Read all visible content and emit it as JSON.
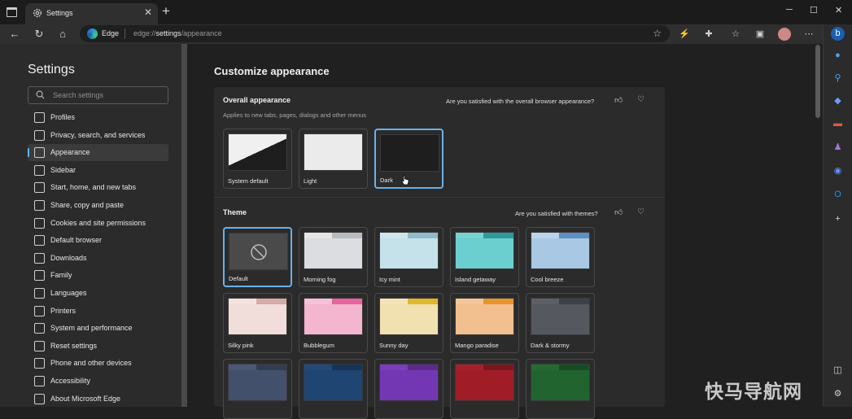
{
  "window": {
    "tab_title": "Settings",
    "tab_close": "✕",
    "new_tab": "+",
    "minimize": "─",
    "maximize": "☐",
    "close": "✕"
  },
  "toolbar": {
    "back": "←",
    "refresh": "↻",
    "home": "⌂",
    "edge_label": "Edge",
    "url_prefix": "edge://",
    "url_bold": "settings",
    "url_suffix": "/appearance",
    "more": "⋯"
  },
  "sidebar": {
    "title": "Settings",
    "search_placeholder": "Search settings",
    "items": [
      {
        "label": "Profiles",
        "icon": "profile-icon"
      },
      {
        "label": "Privacy, search, and services",
        "icon": "lock-icon"
      },
      {
        "label": "Appearance",
        "icon": "palette-icon",
        "active": true
      },
      {
        "label": "Sidebar",
        "icon": "sidebar-icon"
      },
      {
        "label": "Start, home, and new tabs",
        "icon": "home-icon"
      },
      {
        "label": "Share, copy and paste",
        "icon": "share-icon"
      },
      {
        "label": "Cookies and site permissions",
        "icon": "cookie-icon"
      },
      {
        "label": "Default browser",
        "icon": "browser-icon"
      },
      {
        "label": "Downloads",
        "icon": "download-icon"
      },
      {
        "label": "Family",
        "icon": "family-icon"
      },
      {
        "label": "Languages",
        "icon": "language-icon"
      },
      {
        "label": "Printers",
        "icon": "printer-icon"
      },
      {
        "label": "System and performance",
        "icon": "system-icon"
      },
      {
        "label": "Reset settings",
        "icon": "reset-icon"
      },
      {
        "label": "Phone and other devices",
        "icon": "phone-icon"
      },
      {
        "label": "Accessibility",
        "icon": "accessibility-icon"
      },
      {
        "label": "About Microsoft Edge",
        "icon": "edge-icon"
      }
    ]
  },
  "main": {
    "title": "Customize appearance",
    "overall": {
      "title": "Overall appearance",
      "subtitle": "Applies to new tabs, pages, dialogs and other menus",
      "feedback": "Are you satisfied with the overall browser appearance?",
      "options": [
        {
          "label": "System default",
          "selected": false
        },
        {
          "label": "Light",
          "selected": false
        },
        {
          "label": "Dark",
          "selected": true
        }
      ]
    },
    "theme": {
      "title": "Theme",
      "feedback": "Are you satisfied with themes?",
      "tiles": [
        {
          "label": "Default",
          "selected": true,
          "tab": "#444444",
          "back": "#4a4a4a",
          "front": "#4a4a4a"
        },
        {
          "label": "Morning fog",
          "selected": false,
          "tab": "#e6e6e6",
          "back": "#b8bcc0",
          "front": "#dcdde0"
        },
        {
          "label": "Icy mint",
          "selected": false,
          "tab": "#cfe6ee",
          "back": "#8fbccb",
          "front": "#c5e2ea"
        },
        {
          "label": "Island getaway",
          "selected": false,
          "tab": "#78d3d3",
          "back": "#2e9a9c",
          "front": "#6ccfcf"
        },
        {
          "label": "Cool breeze",
          "selected": false,
          "tab": "#b9d4ec",
          "back": "#5d8fc1",
          "front": "#a9c8e4"
        },
        {
          "label": "Silky pink",
          "selected": false,
          "tab": "#f5e2df",
          "back": "#d6aaa6",
          "front": "#f1ddd9"
        },
        {
          "label": "Bubblegum",
          "selected": false,
          "tab": "#f8c1d8",
          "back": "#e7649f",
          "front": "#f4b5cf"
        },
        {
          "label": "Sunny day",
          "selected": false,
          "tab": "#f3e3b7",
          "back": "#e0b82a",
          "front": "#f1e0b0"
        },
        {
          "label": "Mango paradise",
          "selected": false,
          "tab": "#f5c69a",
          "back": "#e8932c",
          "front": "#f2bf8f"
        },
        {
          "label": "Dark & stormy",
          "selected": false,
          "tab": "#5c5f66",
          "back": "#3d4046",
          "front": "#55585e"
        },
        {
          "label": "",
          "selected": false,
          "tab": "#4a5876",
          "back": "#333d52",
          "front": "#43506c"
        },
        {
          "label": "",
          "selected": false,
          "tab": "#22497a",
          "back": "#163457",
          "front": "#1f4572"
        },
        {
          "label": "",
          "selected": false,
          "tab": "#7a3dbb",
          "back": "#5a2b8c",
          "front": "#7437b4"
        },
        {
          "label": "",
          "selected": false,
          "tab": "#a5202b",
          "back": "#7c151e",
          "front": "#a01d28"
        },
        {
          "label": "",
          "selected": false,
          "tab": "#246b33",
          "back": "#174d23",
          "front": "#216430"
        }
      ]
    }
  },
  "watermark": "快马导航网"
}
